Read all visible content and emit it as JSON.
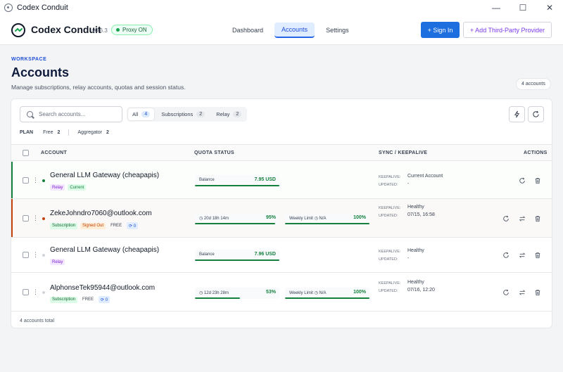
{
  "window": {
    "title": "Codex Conduit",
    "minimize": "—",
    "maximize": "☐",
    "close": "✕"
  },
  "header": {
    "brand": "Codex Conduit",
    "version": "v0.6.3",
    "proxy_status": "Proxy ON",
    "nav": [
      "Dashboard",
      "Accounts",
      "Settings"
    ],
    "sign_in": "+ Sign In",
    "add_provider": "+ Add Third-Party Provider"
  },
  "page": {
    "eyebrow": "WORKSPACE",
    "title": "Accounts",
    "subtitle": "Manage subscriptions, relay accounts, quotas and session status.",
    "count_pill": "4 accounts"
  },
  "toolbar": {
    "search_placeholder": "Search accounts...",
    "filters": [
      {
        "label": "All",
        "count": "4"
      },
      {
        "label": "Subscriptions",
        "count": "2"
      },
      {
        "label": "Relay",
        "count": "2"
      }
    ],
    "plan_label": "PLAN",
    "plan_free_label": "Free",
    "plan_free_count": "2",
    "plan_agg_label": "Aggregator",
    "plan_agg_count": "2"
  },
  "table": {
    "headers": {
      "account": "ACCOUNT",
      "quota": "QUOTA STATUS",
      "sync": "SYNC / KEEPALIVE",
      "actions": "ACTIONS"
    },
    "keepalive_label": "KEEPALIVE:",
    "updated_label": "UPDATED:",
    "rows": [
      {
        "name": "General LLM Gateway (cheapapis)",
        "tags": [
          "Relay",
          "Current"
        ],
        "balance_label": "Balance",
        "balance_value": "7.95 USD",
        "keepalive": "Current Account",
        "updated": "-"
      },
      {
        "name": "ZekeJohndro7060@outlook.com",
        "tags": [
          "Subscription",
          "Signed Out",
          "FREE",
          "0"
        ],
        "reset": "20d 18h 14m",
        "quota_pct": "95%",
        "weekly_label": "Weekly Limit",
        "weekly_na": "N/A",
        "weekly_pct": "100%",
        "keepalive": "Healthy",
        "updated": "07/15, 16:58"
      },
      {
        "name": "General LLM Gateway (cheapapis)",
        "tags": [
          "Relay"
        ],
        "balance_label": "Balance",
        "balance_value": "7.96 USD",
        "keepalive": "Healthy",
        "updated": "-"
      },
      {
        "name": "AlphonseTek95944@outlook.com",
        "tags": [
          "Subscription",
          "FREE",
          "0"
        ],
        "reset": "12d 23h 28m",
        "quota_pct": "53%",
        "weekly_label": "Weekly Limit",
        "weekly_na": "N/A",
        "weekly_pct": "100%",
        "keepalive": "Healthy",
        "updated": "07/16, 12:20"
      }
    ],
    "footer": "4 accounts total"
  },
  "colors": {
    "accent": "#1d6fe0",
    "current_border": "#15803d",
    "signed_out_border": "#c2410c",
    "quota_bar": "#15803d"
  }
}
